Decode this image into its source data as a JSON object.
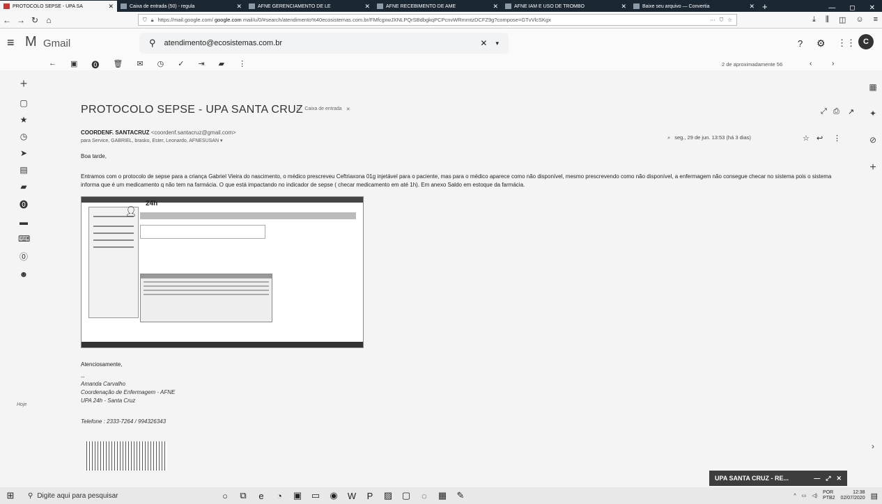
{
  "browser": {
    "tabs": [
      {
        "label": "PROTOCOLO SEPSE - UPA SA"
      },
      {
        "label": "Caixa de entrada (50) - regula"
      },
      {
        "label": "AFNE GERENCIAMENTO DE LE"
      },
      {
        "label": "AFNE RECEBIMENTO DE AME"
      },
      {
        "label": "AFNE IAM E USO DE TROMBO"
      },
      {
        "label": "Baixe seu arquivo — Convertia"
      }
    ],
    "url_prefix": "https://mail.google.com/",
    "url_domain": "google.com",
    "url_rest": "mail/u/0/#search/atendimento%40ecosistemas.com.br/FMfcgxwJXNLPQrSBdbgkqPCPcnvWRmmtzDCFZ9g?compose=GTvVlcSKgx"
  },
  "gmail": {
    "brand": "Gmail",
    "search_value": "atendimento@ecosistemas.com.br",
    "pagination": "2 de aproximadamente 56"
  },
  "email": {
    "subject": "PROTOCOLO SEPSE - UPA SANTA CRUZ",
    "label": "Caixa de entrada",
    "sender_name": "COORDENF. SANTACRUZ",
    "sender_email": "<coordenf.santacruz@gmail.com>",
    "recipients": "para Service, GABRIEL, brasko, Ester, Leonardo, AFNESUSAN",
    "date": "seg., 29 de jun. 13:53 (há 3 dias)",
    "greeting": "Boa tarde,",
    "paragraph": "Entramos com o protocolo de sepse para a criança Gabriel Vieira do nascimento, o médico prescreveu Ceftriaxona 01g injetável para o paciente, mas para o médico aparece como não disponível, mesmo prescrevendo como não disponível, a enfermagem não consegue checar no sistema pois o sistema informa que é um medicamento q não tem na farmácia. O que está impactando no indicador de sepse ( checar medicamento em até 1h). Em anexo Saldo em estoque da farmácia.",
    "closing": "Atenciosamente,",
    "sig_dash": "--",
    "sig_name": "Amanda Carvalho",
    "sig_role": "Coordenação de Enfermagem - AFNE",
    "sig_unit": "UPA 24h - Santa Cruz",
    "sig_phone": "Telefone : 2333-7264 / 994326343",
    "attachment_logo": "24h"
  },
  "left_rail_label": "Hoje",
  "chat": {
    "title": "UPA SANTA CRUZ - RE..."
  },
  "taskbar": {
    "search_placeholder": "Digite aqui para pesquisar",
    "lang1": "POR",
    "lang2": "PTB2",
    "time": "12:38",
    "date": "02/07/2020"
  }
}
